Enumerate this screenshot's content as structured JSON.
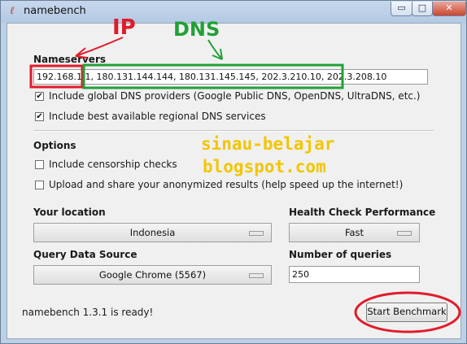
{
  "window": {
    "title": "namebench",
    "icon": "tk-feather-icon",
    "controls": {
      "minimize": "▭",
      "maximize": "□",
      "close": "✕"
    }
  },
  "nameservers": {
    "heading": "Nameservers",
    "value": "192.168.1.1, 180.131.144.144, 180.131.145.145, 202.3.210.10, 202.3.208.10",
    "include_global_label": "Include global DNS providers (Google Public DNS, OpenDNS, UltraDNS, etc.)",
    "include_global_checked": true,
    "include_regional_label": "Include best available regional DNS services",
    "include_regional_checked": true
  },
  "options": {
    "heading": "Options",
    "censorship_label": "Include censorship checks",
    "censorship_checked": false,
    "upload_label": "Upload and share your anonymized results (help speed up the internet!)",
    "upload_checked": false
  },
  "location": {
    "label": "Your location",
    "value": "Indonesia"
  },
  "health": {
    "label": "Health Check Performance",
    "value": "Fast"
  },
  "query_source": {
    "label": "Query Data Source",
    "value": "Google Chrome (5567)"
  },
  "queries": {
    "label": "Number of queries",
    "value": "250"
  },
  "status": "namebench 1.3.1 is ready!",
  "start_button": "Start Benchmark",
  "annotations": {
    "ip_label": "IP",
    "dns_label": "DNS",
    "watermark_line1": "sinau-belajar",
    "watermark_line2": "blogspot.com",
    "ip_color": "#e01b2b",
    "dns_color": "#21a036",
    "watermark_color": "#f3c500"
  }
}
